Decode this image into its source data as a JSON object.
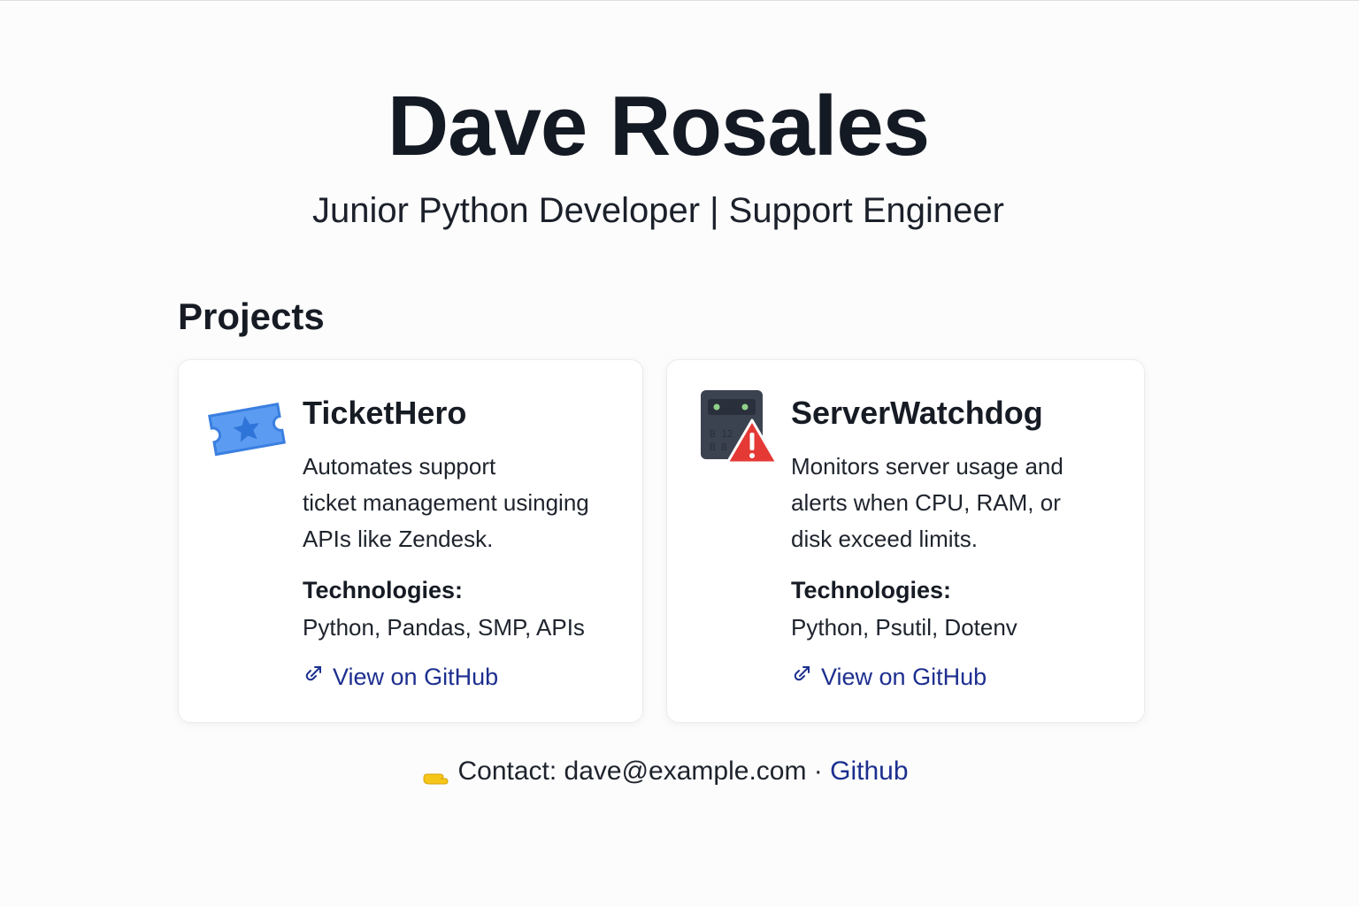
{
  "header": {
    "name": "Dave Rosales",
    "subtitle": "Junior Python Developer | Support Engineer"
  },
  "projects": {
    "section_title": "Projects",
    "items": [
      {
        "icon": "ticket-star-icon",
        "title": "TicketHero",
        "description": "Automates support\nticket management  usinging\nAPIs like Zendesk.",
        "tech_label": "Technologies:",
        "tech_value": "Python, Pandas, SMP, APIs",
        "link_label": "View on GitHub",
        "link_icon": "external-link-icon"
      },
      {
        "icon": "server-alert-icon",
        "title": "ServerWatchdog",
        "description": "Monitors server usage and\nalerts when CPU, RAM, or\ndisk exceed limits.",
        "tech_label": "Technologies:",
        "tech_value": "Python, Psutil, Dotenv",
        "link_label": "View on GitHub",
        "link_icon": "external-link-icon"
      }
    ]
  },
  "footer": {
    "icon": "pointing-hand-icon",
    "contact_text": "Contact: dave@example.com · ",
    "github_label": "Github"
  },
  "colors": {
    "text": "#161b24",
    "link": "#1d2f8f",
    "ticket_blue": "#4a8ff0",
    "alert_red": "#e53935",
    "server_dark": "#3b4250"
  }
}
